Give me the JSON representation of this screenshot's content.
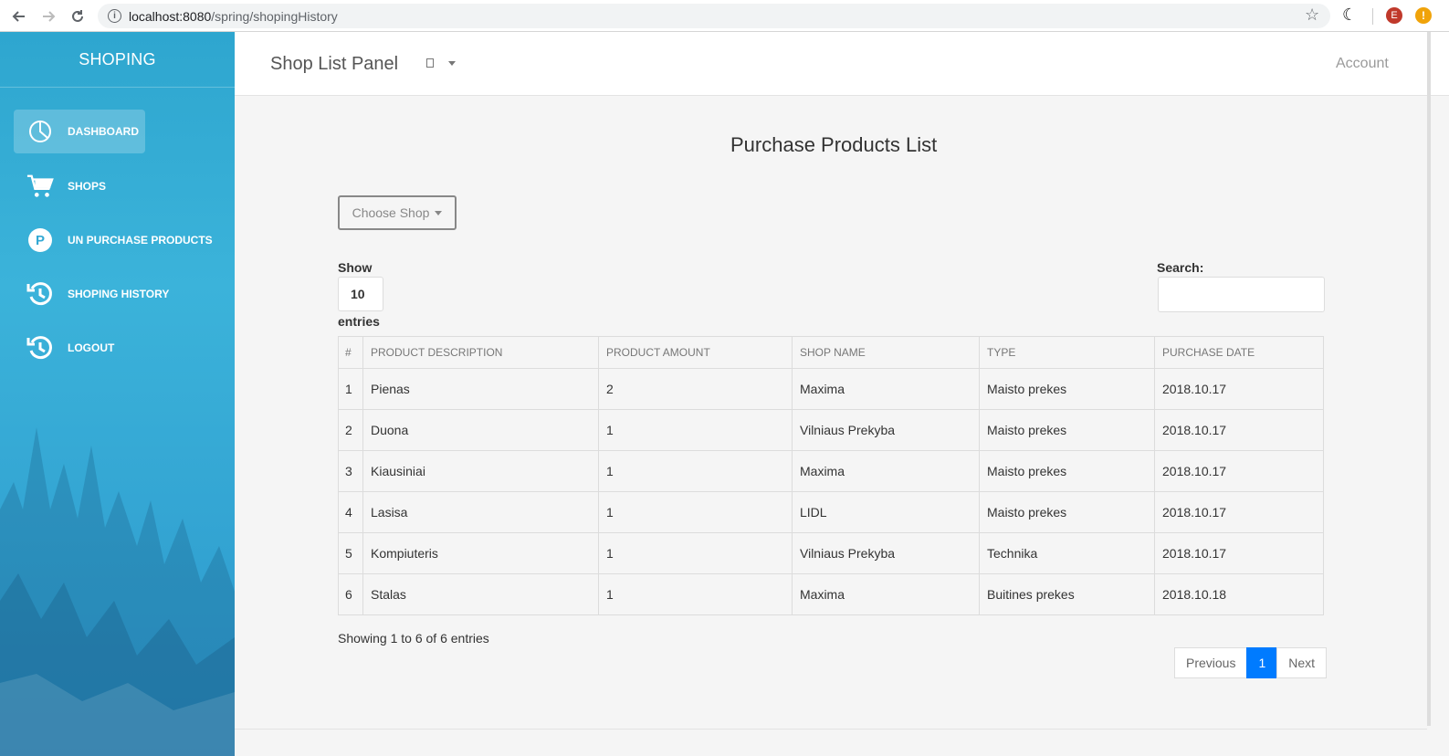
{
  "browser": {
    "url_host": "localhost:8080",
    "url_path": "/spring/shopingHistory",
    "profile_initial": "E",
    "alert_glyph": "!"
  },
  "sidebar": {
    "brand": "SHOPING",
    "items": [
      {
        "label": "DASHBOARD",
        "icon": "pie-chart-icon",
        "active": true
      },
      {
        "label": "SHOPS",
        "icon": "shopping-cart-icon",
        "active": false
      },
      {
        "label": "UN PURCHASE PRODUCTS",
        "icon": "parking-p-icon",
        "active": false
      },
      {
        "label": "SHOPING HISTORY",
        "icon": "history-icon",
        "active": false
      },
      {
        "label": "LOGOUT",
        "icon": "history-icon",
        "active": false
      }
    ]
  },
  "topbar": {
    "title": "Shop List Panel",
    "account": "Account"
  },
  "main": {
    "title": "Purchase Products List",
    "choose_shop": "Choose Shop",
    "show_label": "Show",
    "show_value": "10",
    "entries_label": "entries",
    "search_label": "Search:",
    "search_value": "",
    "table": {
      "headers": [
        "#",
        "PRODUCT DESCRIPTION",
        "PRODUCT AMOUNT",
        "SHOP NAME",
        "TYPE",
        "PURCHASE DATE"
      ],
      "rows": [
        [
          "1",
          "Pienas",
          "2",
          "Maxima",
          "Maisto prekes",
          "2018.10.17"
        ],
        [
          "2",
          "Duona",
          "1",
          "Vilniaus Prekyba",
          "Maisto prekes",
          "2018.10.17"
        ],
        [
          "3",
          "Kiausiniai",
          "1",
          "Maxima",
          "Maisto prekes",
          "2018.10.17"
        ],
        [
          "4",
          "Lasisa",
          "1",
          "LIDL",
          "Maisto prekes",
          "2018.10.17"
        ],
        [
          "5",
          "Kompiuteris",
          "1",
          "Vilniaus Prekyba",
          "Technika",
          "2018.10.17"
        ],
        [
          "6",
          "Stalas",
          "1",
          "Maxima",
          "Buitines prekes",
          "2018.10.18"
        ]
      ]
    },
    "showing_text": "Showing 1 to 6 of 6 entries",
    "pagination": {
      "previous": "Previous",
      "current": "1",
      "next": "Next"
    }
  },
  "colors": {
    "sidebar_top": "#2ea6cf",
    "sidebar_bottom": "#2c97cc",
    "page_active": "#007bff"
  }
}
